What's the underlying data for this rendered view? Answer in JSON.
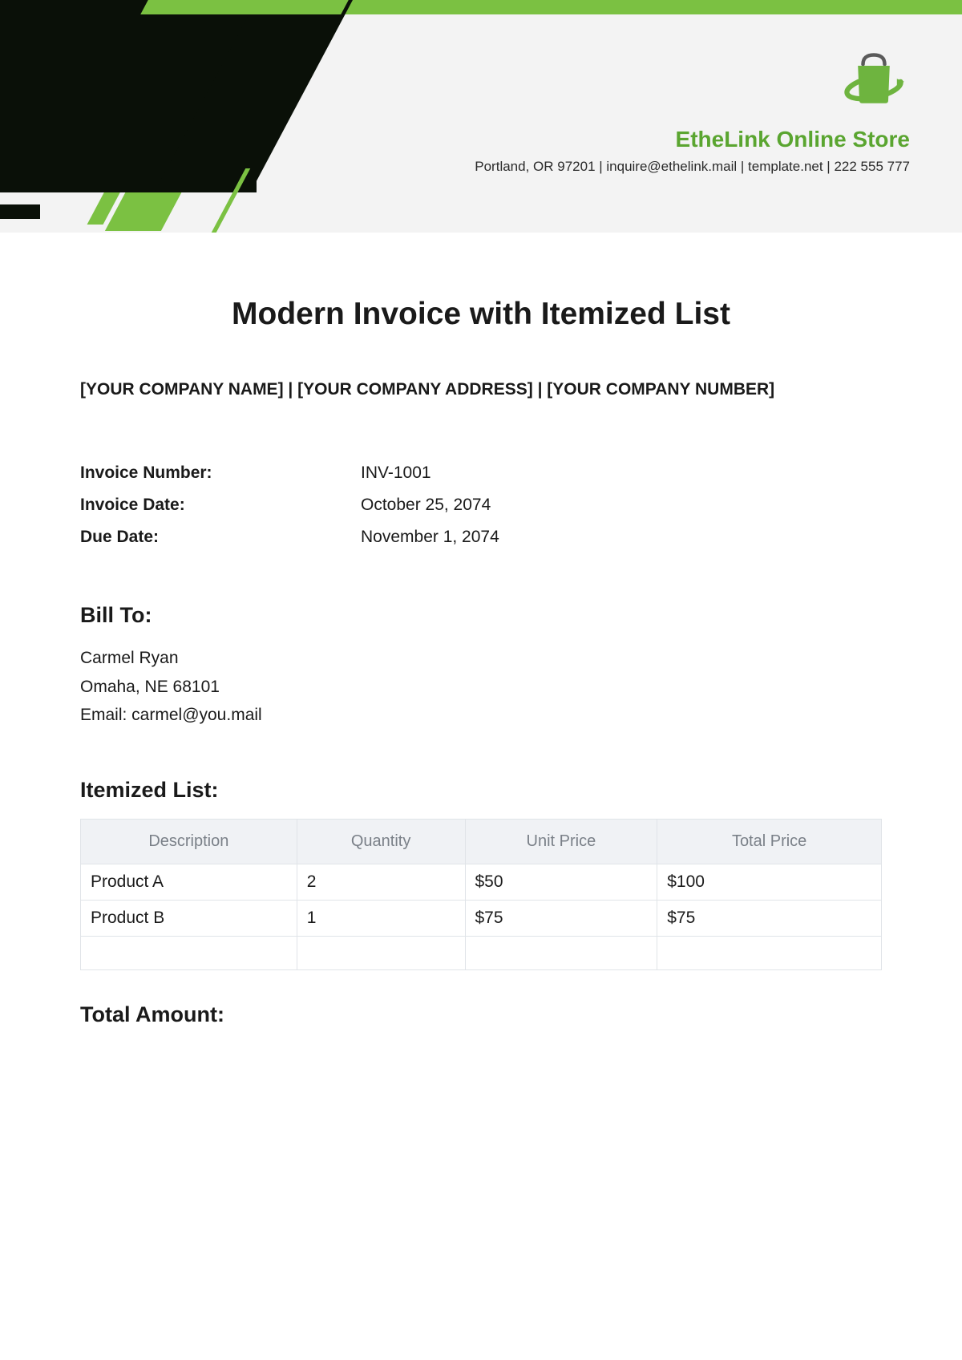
{
  "company": {
    "name": "EtheLink Online Store",
    "info": "Portland, OR 97201 | inquire@ethelink.mail | template.net | 222 555 777"
  },
  "title": "Modern Invoice with Itemized List",
  "placeholders": "[YOUR COMPANY NAME] | [YOUR COMPANY ADDRESS] | [YOUR COMPANY NUMBER]",
  "meta": {
    "invoice_number_label": "Invoice Number:",
    "invoice_number": "INV-1001",
    "invoice_date_label": "Invoice Date:",
    "invoice_date": "October 25, 2074",
    "due_date_label": "Due Date:",
    "due_date": "November 1, 2074"
  },
  "bill_to": {
    "heading": "Bill To:",
    "name": "Carmel Ryan",
    "address": "Omaha, NE 68101",
    "email": "Email: carmel@you.mail"
  },
  "itemized": {
    "heading": "Itemized List:",
    "headers": {
      "description": "Description",
      "quantity": "Quantity",
      "unit_price": "Unit Price",
      "total_price": "Total Price"
    },
    "rows": [
      {
        "description": "Product A",
        "quantity": "2",
        "unit_price": "$50",
        "total_price": "$100"
      },
      {
        "description": "Product B",
        "quantity": "1",
        "unit_price": "$75",
        "total_price": "$75"
      }
    ]
  },
  "total_heading": "Total Amount:"
}
